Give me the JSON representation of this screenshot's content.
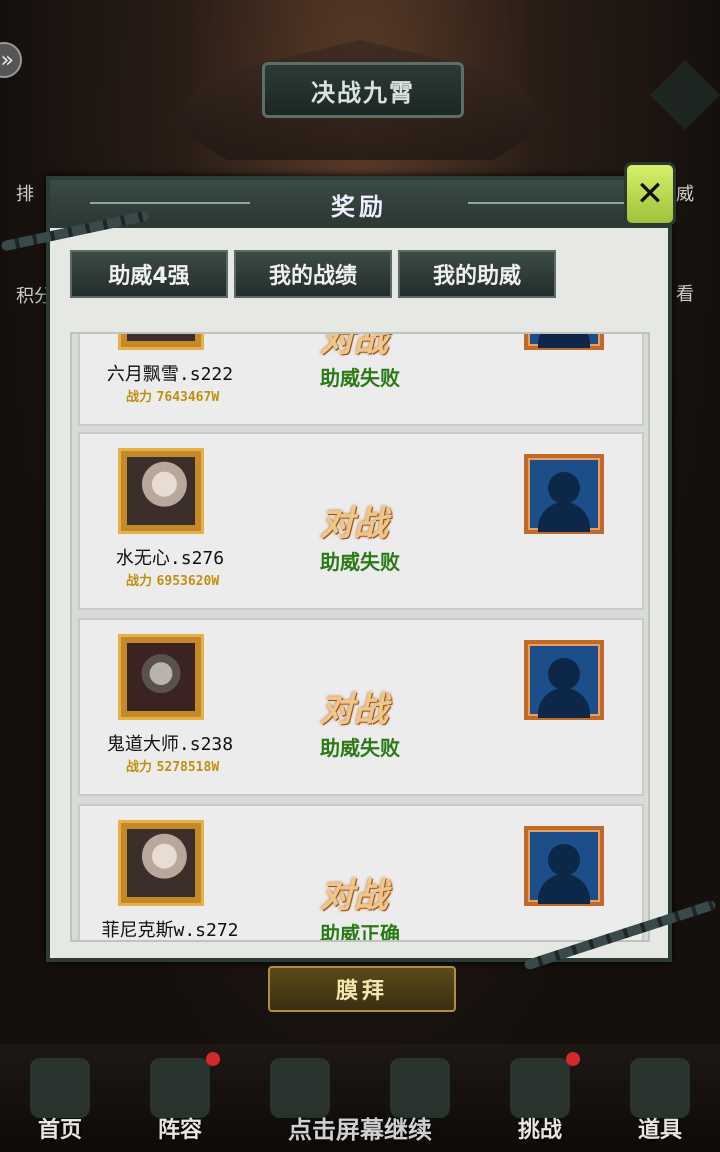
{
  "header": {
    "title": "决战九霄"
  },
  "side_labels": [
    "排",
    "积分",
    "威",
    "看"
  ],
  "dialog": {
    "title": "奖励",
    "tabs": [
      "助威4强",
      "我的战绩",
      "我的助威"
    ]
  },
  "records": [
    {
      "player": "六月飘雪.s222",
      "power_label": "战力",
      "power": "7643467W",
      "vs": "对战",
      "result": "助威失败"
    },
    {
      "player": "水无心.s276",
      "power_label": "战力",
      "power": "6953620W",
      "vs": "对战",
      "result": "助威失败"
    },
    {
      "player": "鬼道大师.s238",
      "power_label": "战力",
      "power": "5278518W",
      "vs": "对战",
      "result": "助威失败"
    },
    {
      "player": "菲尼克斯w.s272",
      "power_label": "",
      "power": "",
      "vs": "对战",
      "result": "助威正确"
    }
  ],
  "worship_button": "膜拜",
  "bottom_nav": [
    {
      "label": "首页",
      "dot": false
    },
    {
      "label": "阵容",
      "dot": true
    },
    {
      "label": "",
      "dot": false
    },
    {
      "label": "",
      "dot": false
    },
    {
      "label": "挑战",
      "dot": true
    },
    {
      "label": "道具",
      "dot": false
    }
  ],
  "continue_hint": "点击屏幕继续"
}
